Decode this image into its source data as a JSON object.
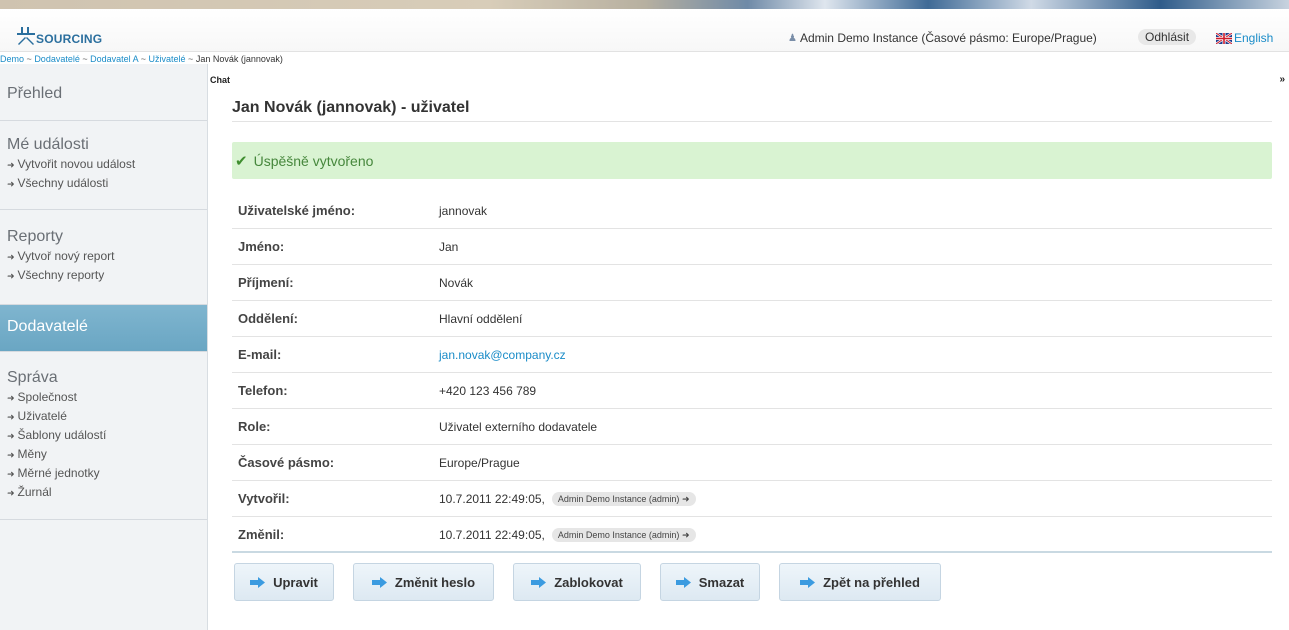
{
  "header": {
    "logo_text": "SOURCING",
    "user_info": "Admin Demo Instance (Časové pásmo: Europe/Prague)",
    "logout_label": "Odhlásit",
    "language_label": "English"
  },
  "breadcrumb": {
    "items": [
      "Demo",
      "Dodavatelé",
      "Dodavatel A",
      "Uživatelé"
    ],
    "separator": "~",
    "current": "Jan Novák (jannovak)"
  },
  "sidebar": {
    "overview": "Přehled",
    "my_events": {
      "title": "Mé události",
      "links": [
        "Vytvořit novou událost",
        "Všechny události"
      ]
    },
    "reports": {
      "title": "Reporty",
      "links": [
        "Vytvoř nový report",
        "Všechny reporty"
      ]
    },
    "suppliers": "Dodavatelé",
    "admin": {
      "title": "Správa",
      "links": [
        "Společnost",
        "Uživatelé",
        "Šablony událostí",
        "Měny",
        "Měrné jednotky",
        "Žurnál"
      ]
    }
  },
  "chat": {
    "label": "Chat",
    "toggle": "»"
  },
  "main": {
    "title": "Jan Novák (jannovak) - uživatel",
    "alert": "Úspěšně vytvořeno",
    "fields": [
      {
        "label": "Uživatelské jméno:",
        "value": "jannovak"
      },
      {
        "label": "Jméno:",
        "value": "Jan"
      },
      {
        "label": "Příjmení:",
        "value": "Novák"
      },
      {
        "label": "Oddělení:",
        "value": "Hlavní oddělení"
      },
      {
        "label": "E-mail:",
        "value": "jan.novak@company.cz"
      },
      {
        "label": "Telefon:",
        "value": "+420 123 456 789"
      },
      {
        "label": "Role:",
        "value": "Uživatel externího dodavatele"
      },
      {
        "label": "Časové pásmo:",
        "value": "Europe/Prague"
      },
      {
        "label": "Vytvořil:",
        "value": "10.7.2011 22:49:05,",
        "pill": "Admin Demo Instance (admin)"
      },
      {
        "label": "Změnil:",
        "value": "10.7.2011 22:49:05,",
        "pill": "Admin Demo Instance (admin)"
      }
    ],
    "buttons": [
      "Upravit",
      "Změnit heslo",
      "Zablokovat",
      "Smazat",
      "Zpět na přehled"
    ]
  },
  "colors": {
    "accent": "#1a8cc8",
    "sidebar_active": "#6aa6c3",
    "alert_bg": "#d9f3d2",
    "alert_text": "#46873c"
  },
  "icons": {
    "logo": "sourcing-logo-icon",
    "user": "user-icon",
    "flag": "uk-flag-icon",
    "check": "check-icon",
    "arrow": "arrow-right-icon"
  }
}
